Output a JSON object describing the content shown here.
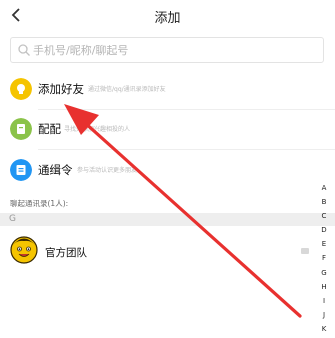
{
  "header": {
    "title": "添加"
  },
  "search": {
    "placeholder": "手机号/昵称/聊起号"
  },
  "menu": [
    {
      "label": "添加好友",
      "desc": "通过微信/qq/通讯录添加好友",
      "icon": "bulb-icon",
      "color": "#f5c400"
    },
    {
      "label": "配配",
      "desc": "寻找并添加兴趣相投的人",
      "icon": "match-icon",
      "color": "#8bc34a"
    },
    {
      "label": "通缉令",
      "desc": "参与活动认识更多朋友",
      "icon": "wanted-icon",
      "color": "#2196f3"
    }
  ],
  "contacts_section": {
    "caption": "聊起通讯录(1人):",
    "group": "G"
  },
  "contacts": [
    {
      "name": "官方团队"
    }
  ],
  "index_letters": [
    "A",
    "B",
    "C",
    "D",
    "E",
    "F",
    "G",
    "H",
    "I",
    "J",
    "K"
  ],
  "colors": {
    "arrow": "#e8312f"
  }
}
